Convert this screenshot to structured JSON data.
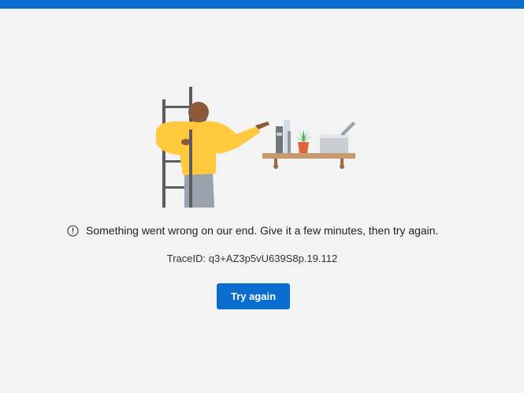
{
  "error": {
    "message": "Something went wrong on our end. Give it a few minutes, then try again.",
    "icon": "info-circle-icon"
  },
  "trace": {
    "text": "TraceID: q3+AZ3p5vU639S8p.19.112"
  },
  "actions": {
    "try_again_label": "Try again"
  },
  "colors": {
    "accent": "#0a6cce",
    "background": "#f3f3f3"
  }
}
